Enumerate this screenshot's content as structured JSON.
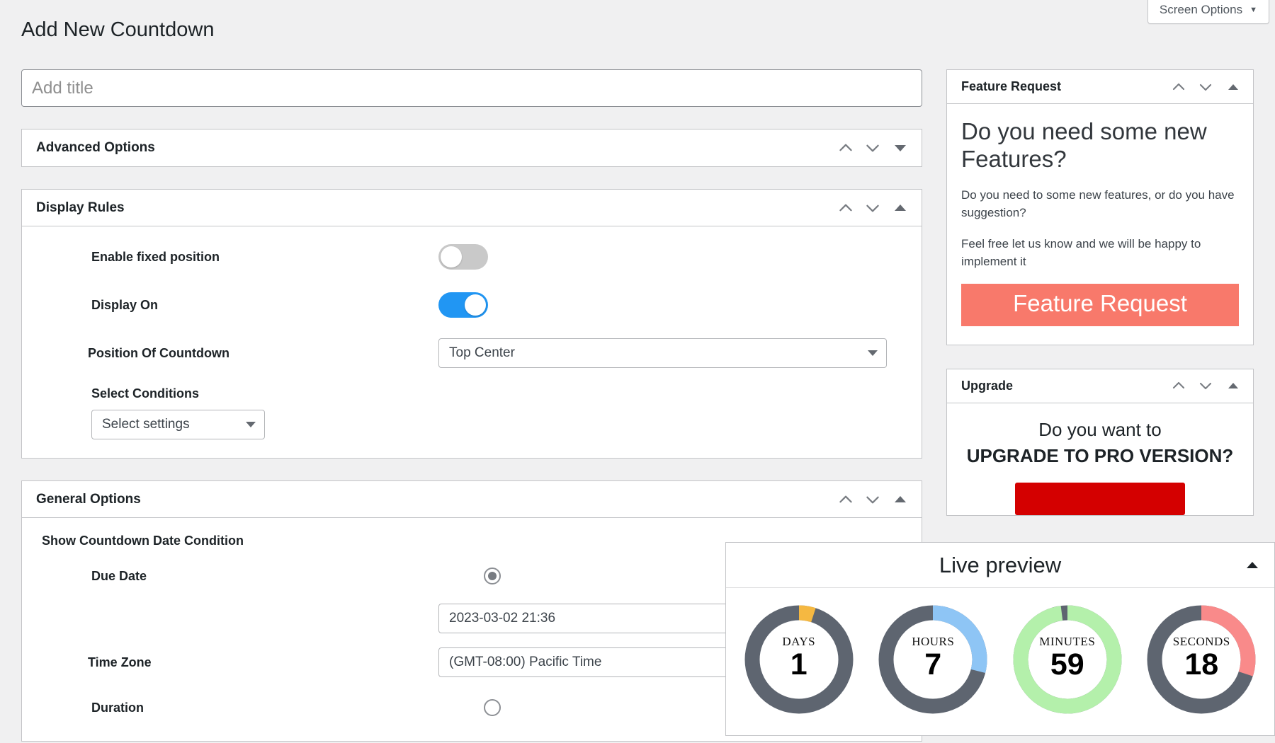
{
  "screen_options": {
    "label": "Screen Options",
    "caret": "chevron-down-icon"
  },
  "page": {
    "title": "Add New Countdown"
  },
  "title_field": {
    "placeholder": "Add title",
    "value": ""
  },
  "panels": {
    "advanced_options": {
      "title": "Advanced Options",
      "state": "collapsed",
      "toggle_icon": "triangle-down-icon"
    },
    "display_rules": {
      "title": "Display Rules",
      "state": "expanded",
      "toggle_icon": "triangle-up-icon",
      "fields": {
        "enable_fixed_position": {
          "label": "Enable fixed position",
          "value": "off"
        },
        "display_on": {
          "label": "Display On",
          "value": "on"
        },
        "position_of_countdown": {
          "label": "Position Of Countdown",
          "value": "Top Center"
        },
        "select_conditions": {
          "label": "Select Conditions",
          "value": "Select settings"
        }
      }
    },
    "general_options": {
      "title": "General Options",
      "state": "expanded",
      "toggle_icon": "triangle-up-icon",
      "section_heading": "Show Countdown Date Condition",
      "fields": {
        "due_date": {
          "label": "Due Date",
          "radio": "checked"
        },
        "due_date_value": {
          "value": "2023-03-02 21:36"
        },
        "time_zone": {
          "label": "Time Zone",
          "value": "(GMT-08:00) Pacific Time"
        },
        "duration": {
          "label": "Duration",
          "radio": "unchecked"
        }
      }
    }
  },
  "sidebar": {
    "feature_request": {
      "title": "Feature Request",
      "heading": "Do you need some new Features?",
      "para1": "Do you need to some new features, or do you have suggestion?",
      "para2": "Feel free let us know and we will be happy to implement it",
      "button": "Feature Request",
      "button_color": "#f8796b",
      "toggle_icon": "triangle-up-icon"
    },
    "upgrade": {
      "title": "Upgrade",
      "line1": "Do you want to",
      "line2": "UPGRADE TO PRO VERSION?",
      "button": "",
      "button_color": "#d40000",
      "toggle_icon": "triangle-up-icon"
    }
  },
  "live_preview": {
    "title": "Live preview",
    "toggle_icon": "triangle-up-icon",
    "rings": [
      {
        "label": "DAYS",
        "value": "1",
        "percent": 5,
        "color": "#f5b841",
        "track": "#5e6570"
      },
      {
        "label": "HOURS",
        "value": "7",
        "percent": 29,
        "color": "#8ec5f5",
        "track": "#5e6570"
      },
      {
        "label": "MINUTES",
        "value": "59",
        "percent": 98,
        "color": "#b4f0ab",
        "track": "#5e6570"
      },
      {
        "label": "SECONDS",
        "value": "18",
        "percent": 30,
        "color": "#f98a8a",
        "track": "#5e6570"
      }
    ]
  }
}
